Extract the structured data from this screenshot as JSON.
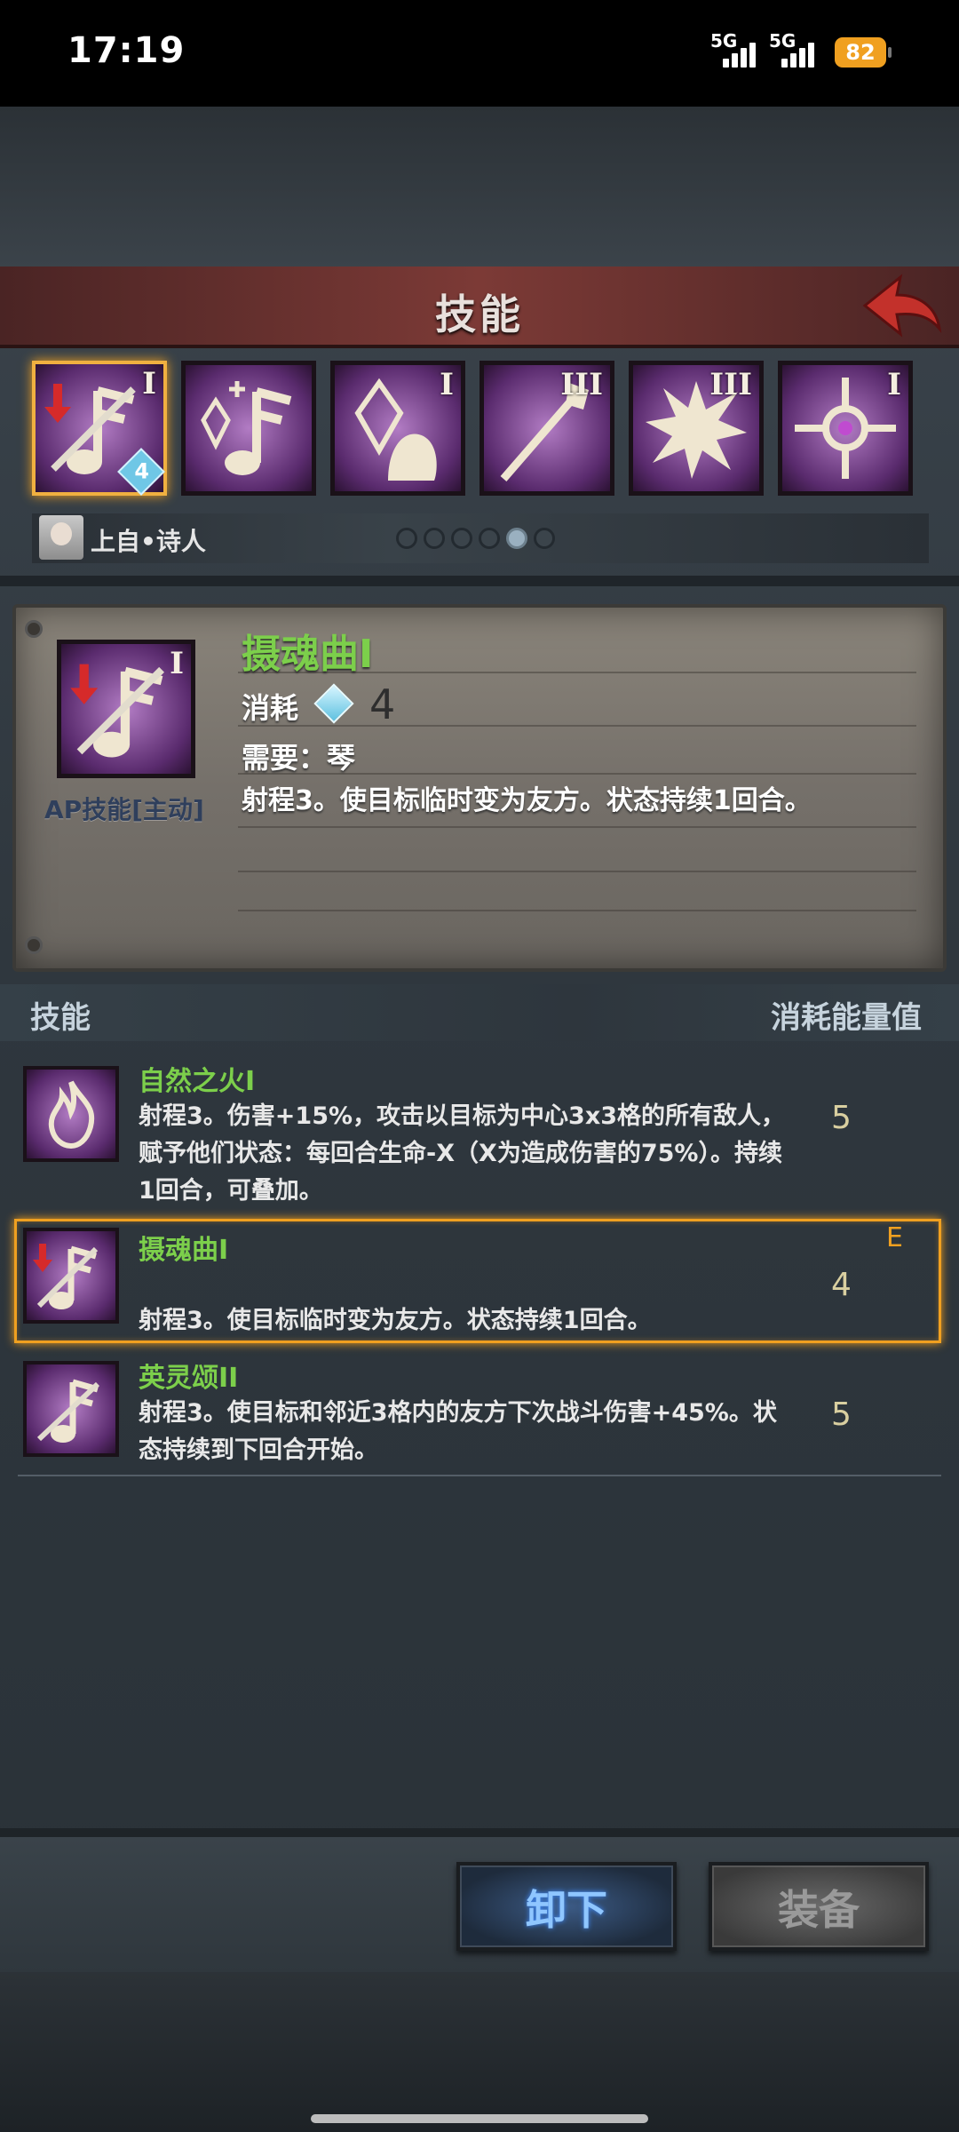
{
  "status": {
    "time": "17:19",
    "sim1": "5G",
    "sim2": "5G",
    "battery": "82"
  },
  "header": {
    "title": "技能"
  },
  "skill_bar": {
    "tiles": [
      {
        "roman": "I",
        "cost": "4",
        "selected": true
      },
      {
        "roman": ""
      },
      {
        "roman": "I"
      },
      {
        "roman": "III"
      },
      {
        "roman": "III"
      },
      {
        "roman": "I"
      }
    ]
  },
  "character": {
    "name": "上自•诗人"
  },
  "detail": {
    "icon_roman": "I",
    "type_label": "AP技能[主动]",
    "name": "摄魂曲I",
    "cost_label": "消耗",
    "cost_value": "4",
    "requirement": "需要：琴",
    "description": "射程3。使目标临时变为友方。状态持续1回合。"
  },
  "list_header": {
    "left": "技能",
    "right": "消耗能量值"
  },
  "skills": [
    {
      "name": "自然之火I",
      "description": "射程3。伤害+15%，攻击以目标为中心3x3格的所有敌人，赋予他们状态：每回合生命-X（X为造成伤害的75%）。持续1回合，可叠加。",
      "cost": "5"
    },
    {
      "name": "摄魂曲I",
      "description": "射程3。使目标临时变为友方。状态持续1回合。",
      "cost": "4",
      "equipped_mark": "E"
    },
    {
      "name": "英灵颂II",
      "description": "射程3。使目标和邻近3格内的友方下次战斗伤害+45%。状态持续到下回合开始。",
      "cost": "5"
    }
  ],
  "buttons": {
    "unequip": "卸下",
    "equip": "装备"
  },
  "colors": {
    "accent_gold": "#f0a020",
    "skill_name_green": "#7ccf4b",
    "battery": "#f0a020"
  }
}
